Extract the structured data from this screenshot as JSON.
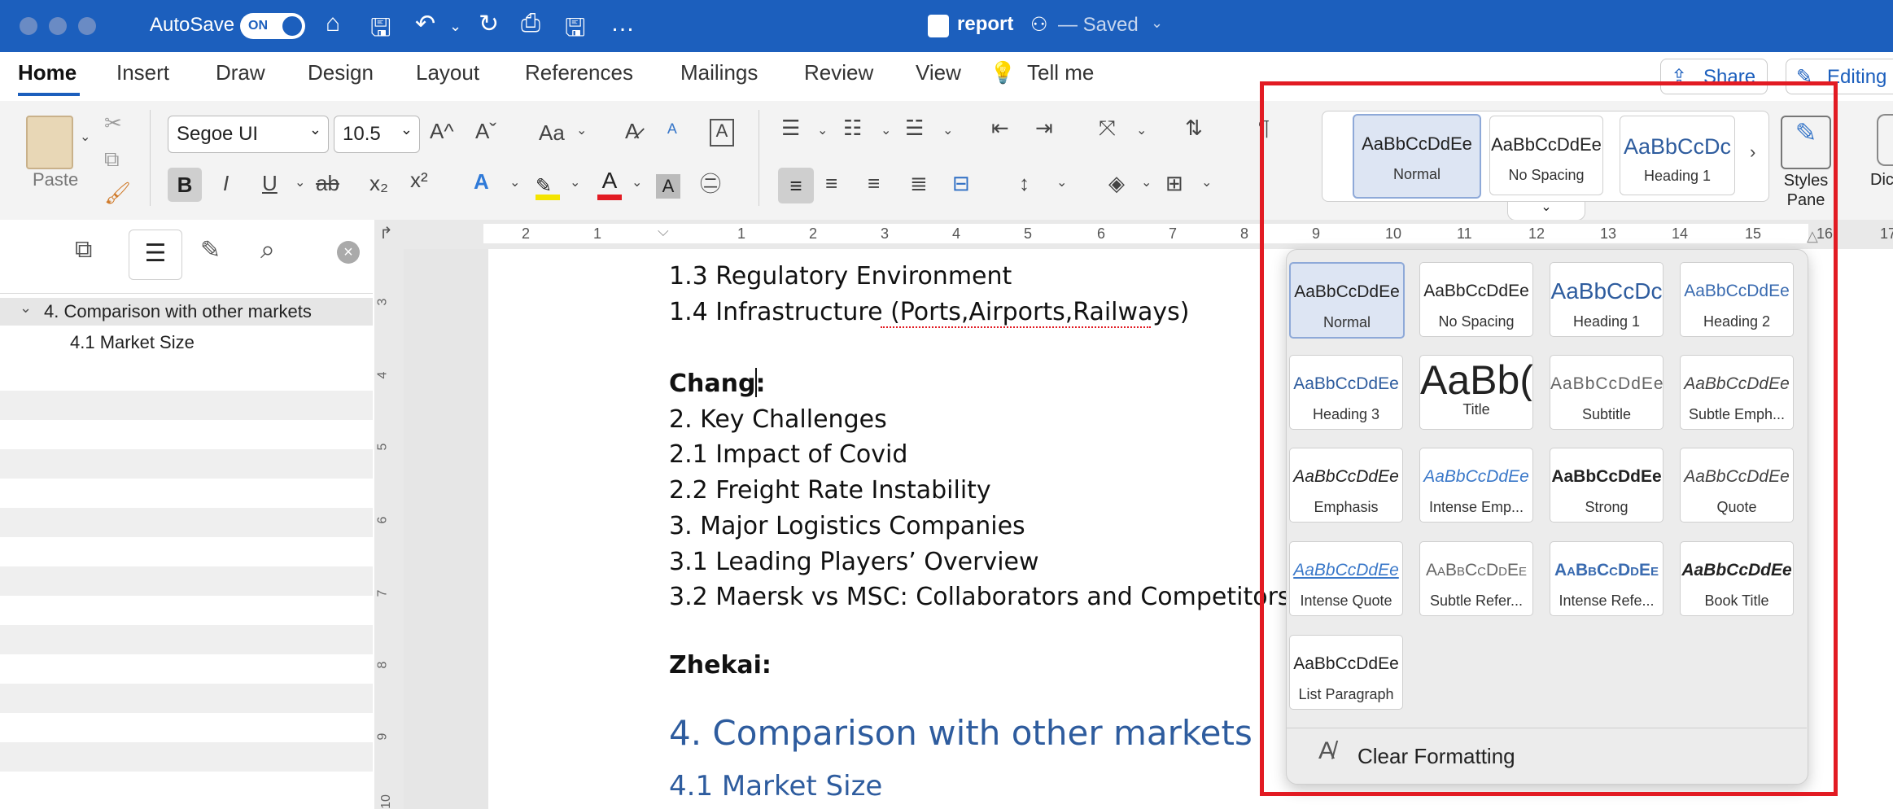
{
  "titlebar": {
    "autosave_label": "AutoSave",
    "autosave_state": "ON",
    "doc_name": "report",
    "doc_status": "— Saved",
    "icons": [
      "home-icon",
      "save-icon",
      "undo-icon",
      "redo-icon",
      "print-icon",
      "save-as-icon",
      "more-icon"
    ]
  },
  "tabs": [
    "Home",
    "Insert",
    "Draw",
    "Design",
    "Layout",
    "References",
    "Mailings",
    "Review",
    "View"
  ],
  "tell_me": "Tell me",
  "share_label": "Share",
  "editing_label": "Editing",
  "ribbon": {
    "paste_label": "Paste",
    "font_name": "Segoe UI",
    "font_size": "10.5",
    "case_label": "Aa",
    "styles_pane_label": "Styles\nPane",
    "dictate_label": "Dic",
    "gallery": [
      {
        "preview": "AaBbCcDdEe",
        "label": "Normal"
      },
      {
        "preview": "AaBbCcDdEe",
        "label": "No Spacing"
      },
      {
        "preview": "AaBbCcDc",
        "label": "Heading 1"
      }
    ]
  },
  "ruler": {
    "marks": [
      "2",
      "1",
      "1",
      "2",
      "3",
      "4",
      "5",
      "6",
      "7",
      "8",
      "9",
      "10",
      "11",
      "12",
      "13",
      "14",
      "15",
      "16",
      "17"
    ],
    "vmarks": [
      "3",
      "4",
      "5",
      "6",
      "7",
      "8",
      "9",
      "10"
    ]
  },
  "navpane": {
    "items": [
      {
        "label": "4. Comparison with other markets",
        "level": 1
      },
      {
        "label": "4.1 Market Size",
        "level": 2
      }
    ]
  },
  "document": {
    "lines": [
      "1.3 Regulatory Environment",
      "1.4 Infrastructure (Ports,Airports,Railways)",
      "Chang:",
      "2. Key Challenges",
      "2.1 Impact of Covid",
      "2.2 Freight Rate Instability",
      "3. Major Logistics Companies",
      "3.1 Leading Players’ Overview",
      "3.2 Maersk vs MSC: Collaborators and Competitors",
      "Zhekai:"
    ],
    "heading1": "4. Comparison with other markets",
    "heading2": "4.1 Market Size"
  },
  "styles_dropdown": {
    "styles": [
      {
        "preview": "AaBbCcDdEe",
        "label": "Normal"
      },
      {
        "preview": "AaBbCcDdEe",
        "label": "No Spacing"
      },
      {
        "preview": "AaBbCcDc",
        "label": "Heading 1"
      },
      {
        "preview": "AaBbCcDdEe",
        "label": "Heading 2"
      },
      {
        "preview": "AaBbCcDdEe",
        "label": "Heading 3"
      },
      {
        "preview": "AaBb(",
        "label": "Title"
      },
      {
        "preview": "AaBbCcDdEe",
        "label": "Subtitle"
      },
      {
        "preview": "AaBbCcDdEe",
        "label": "Subtle Emph..."
      },
      {
        "preview": "AaBbCcDdEe",
        "label": "Emphasis"
      },
      {
        "preview": "AaBbCcDdEe",
        "label": "Intense Emp..."
      },
      {
        "preview": "AaBbCcDdEe",
        "label": "Strong"
      },
      {
        "preview": "AaBbCcDdEe",
        "label": "Quote"
      },
      {
        "preview": "AaBbCcDdEe",
        "label": "Intense Quote"
      },
      {
        "preview": "AaBbCcDdEe",
        "label": "Subtle Refer..."
      },
      {
        "preview": "AaBbCcDdEe",
        "label": "Intense Refe..."
      },
      {
        "preview": "AaBbCcDdEe",
        "label": "Book Title"
      },
      {
        "preview": "AaBbCcDdEe",
        "label": "List Paragraph"
      }
    ],
    "clear_formatting": "Clear Formatting"
  },
  "colors": {
    "accent": "#1c5fbd",
    "highlight_box": "#e21b23",
    "heading": "#2e5c9e"
  }
}
